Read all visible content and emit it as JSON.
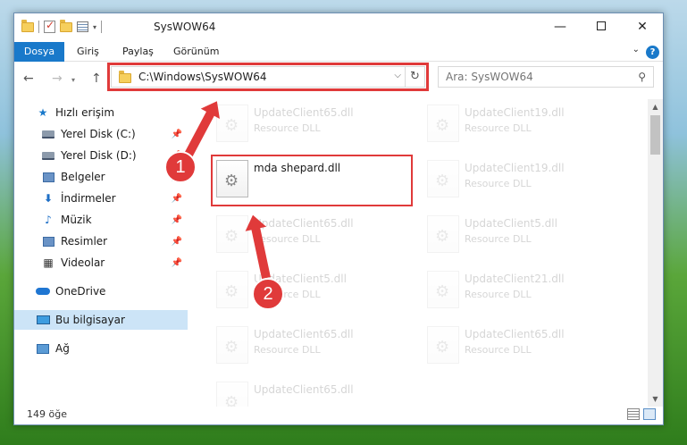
{
  "window": {
    "title": "SysWOW64",
    "controls": {
      "minimize": "—",
      "maximize": "",
      "close": "✕"
    }
  },
  "ribbon": {
    "tabs": [
      "Dosya",
      "Giriş",
      "Paylaş",
      "Görünüm"
    ],
    "help": "?"
  },
  "address_bar": {
    "path": "C:\\Windows\\SysWOW64"
  },
  "search": {
    "placeholder": "Ara: SysWOW64"
  },
  "sidebar": {
    "items": [
      {
        "label": "Hızlı erişim",
        "icon": "star-icon",
        "pinned": false
      },
      {
        "label": "Yerel Disk (C:)",
        "icon": "drive-icon",
        "pinned": true
      },
      {
        "label": "Yerel Disk (D:)",
        "icon": "drive-icon",
        "pinned": true
      },
      {
        "label": "Belgeler",
        "icon": "documents-icon",
        "pinned": true
      },
      {
        "label": "İndirmeler",
        "icon": "download-icon",
        "pinned": true
      },
      {
        "label": "Müzik",
        "icon": "music-icon",
        "pinned": true
      },
      {
        "label": "Resimler",
        "icon": "pictures-icon",
        "pinned": true
      },
      {
        "label": "Videolar",
        "icon": "video-icon",
        "pinned": true
      },
      {
        "label": "OneDrive",
        "icon": "cloud-icon",
        "pinned": false
      },
      {
        "label": "Bu bilgisayar",
        "icon": "computer-icon",
        "pinned": false,
        "selected": true
      },
      {
        "label": "Ağ",
        "icon": "network-icon",
        "pinned": false
      }
    ]
  },
  "files": {
    "highlighted": {
      "name": "mda shepard.dll",
      "type": ""
    },
    "faded": [
      {
        "name": "UpdateClient65.dll",
        "type": "Resource DLL"
      },
      {
        "name": "UpdateClient19.dll",
        "type": "Resource DLL"
      },
      {
        "name": "UpdateClient19.dll",
        "type": "Resource DLL"
      },
      {
        "name": "UpdateClient65.dll",
        "type": "Resource DLL"
      },
      {
        "name": "UpdateClient5.dll",
        "type": "Resource DLL"
      },
      {
        "name": "UpdateClient5.dll",
        "type": "Resource DLL"
      },
      {
        "name": "UpdateClient21.dll",
        "type": "Resource DLL"
      },
      {
        "name": "UpdateClient65.dll",
        "type": "Resource DLL"
      },
      {
        "name": "UpdateClient65.dll",
        "type": "Resource DLL"
      },
      {
        "name": "UpdateClient65.dll",
        "type": "Resource DLL"
      }
    ]
  },
  "status": {
    "item_count": "149 öğe"
  },
  "callouts": [
    "1",
    "2"
  ],
  "colors": {
    "accent": "#1979ca",
    "highlight": "#e03a3a",
    "selected": "#cce4f7"
  }
}
